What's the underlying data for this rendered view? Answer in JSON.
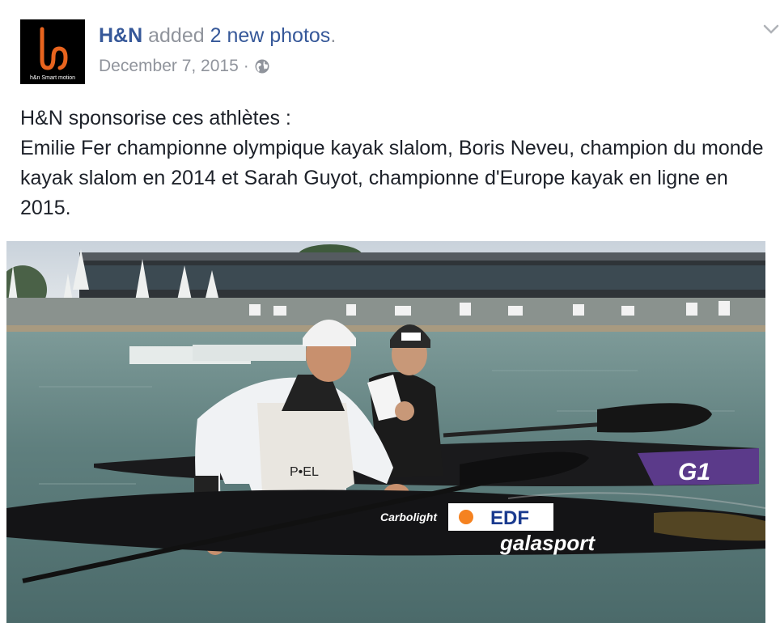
{
  "post": {
    "author": "H&N",
    "action_mid": " added ",
    "action_link": "2 new photos",
    "action_end": ".",
    "date": "December 7, 2015",
    "date_sep": "·",
    "privacy_icon": "globe-icon",
    "options_icon": "chevron-down-icon",
    "text_lines": [
      "H&N sponsorise ces athlètes :",
      "Emilie Fer championne olympique kayak slalom, Boris Neveu, champion du monde kayak slalom en 2014 et Sarah Guyot, championne d'Europe kayak en ligne en 2015."
    ]
  },
  "avatar": {
    "logo_text": "h&n Smart motion"
  },
  "photo": {
    "kayak_brand": "galasport",
    "kayak_sponsor": "EDF",
    "kayak_model": "Carbolight",
    "kayak_logo2": "G1"
  },
  "colors": {
    "link": "#365899",
    "meta": "#90949c",
    "text": "#1d2129",
    "logo_orange": "#e8641e"
  }
}
